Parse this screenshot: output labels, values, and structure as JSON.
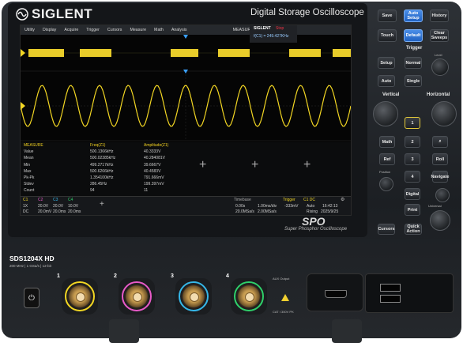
{
  "brand": "SIGLENT",
  "product_title": "Digital Storage Oscilloscope",
  "series_logo": "SPO",
  "series_tagline": "Super Phosphor Oscilloscope",
  "model": "SDS1204X HD",
  "model_specs": "200 MHz | 1 GSa/s | 12-bit",
  "menu": [
    "Utility",
    "Display",
    "Acquire",
    "Trigger",
    "Cursors",
    "Measure",
    "Math",
    "Analysis",
    "MEASURE"
  ],
  "badge": {
    "name": "SIGLENT",
    "status": "Stop",
    "freq": "f(C1) = 249.427KHz"
  },
  "measure": {
    "headers": [
      "MEASURE",
      "Freq(Z1)",
      "Amplitude(Z1)"
    ],
    "rows": [
      [
        "Value",
        "500.1366kHz",
        "40.3333V"
      ],
      [
        "Mean",
        "500.02385kHz",
        "40.284081V"
      ],
      [
        "Min",
        "499.2717kHz",
        "39.6667V"
      ],
      [
        "Max",
        "500.6266kHz",
        "40.4583V"
      ],
      [
        "Pk-Pk",
        "1.354100kHz",
        "791.666mV"
      ],
      [
        "Stdev",
        "286.45Hz",
        "199.397mV"
      ],
      [
        "Count",
        "94",
        "11"
      ]
    ]
  },
  "status": {
    "ch_labels": [
      "C1",
      "C2",
      "C3",
      "C4"
    ],
    "ch_row1": [
      "1X",
      "20.0V",
      "20.0V",
      "10.0V"
    ],
    "ch_row2": [
      "DC",
      "20.0mV",
      "20.0ms",
      "20.0ms"
    ],
    "timebase_label": "Timebase",
    "timebase_delay": "0.00s",
    "timebase_scale": "1.00ms/div",
    "sample_rate": "20.0MSa/s",
    "memory": "2.00MSa/s",
    "trigger_label": "Trigger",
    "trigger_src": "C1 DC",
    "trigger_level": "-333mV",
    "trigger_mode": "Auto",
    "trigger_edge": "Rising",
    "time": "16:42:13",
    "date": "2025/9/25"
  },
  "panel": {
    "save": "Save",
    "auto_setup": "Auto Setup",
    "history": "History",
    "touch": "Touch",
    "default": "Default",
    "clear_sweeps": "Clear Sweeps",
    "trigger_title": "Trigger",
    "setup": "Setup",
    "normal": "Normal",
    "auto": "Auto",
    "single": "Single",
    "level": "Level",
    "vertical_title": "Vertical",
    "horizontal_title": "Horizontal",
    "ch_buttons": [
      "1",
      "2",
      "3",
      "4"
    ],
    "math": "Math",
    "ref": "Ref",
    "digital": "Digital",
    "search": "Search",
    "roll": "Roll",
    "navigate": "Navigate",
    "print": "Print",
    "universal": "Universal",
    "cursors": "Cursors",
    "quick_action": "Quick Action",
    "position": "Position",
    "variable": "Variable"
  },
  "front": {
    "ch_numbers": [
      "1",
      "2",
      "3",
      "4"
    ],
    "ext_label": "AUX Output",
    "cat_label": "CAT I 300V PK"
  },
  "colors": {
    "ch1": "#f2d623",
    "ch2": "#e85ac8",
    "ch3": "#36b7e8",
    "ch4": "#2fcf6a",
    "accent": "#2c74d8"
  }
}
